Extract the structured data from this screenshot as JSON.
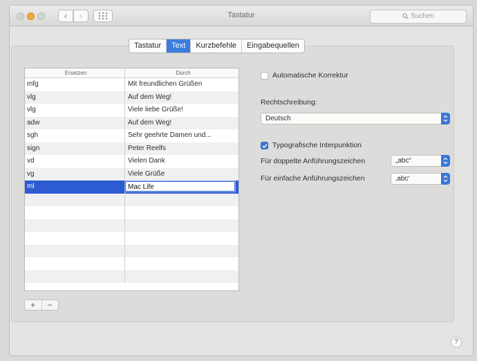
{
  "window": {
    "title": "Tastatur"
  },
  "search": {
    "placeholder": "Suchen"
  },
  "tabs": [
    {
      "label": "Tastatur",
      "active": false
    },
    {
      "label": "Text",
      "active": true
    },
    {
      "label": "Kurzbefehle",
      "active": false
    },
    {
      "label": "Eingabequellen",
      "active": false
    }
  ],
  "table": {
    "headers": {
      "replace": "Ersetzen",
      "with": "Durch"
    },
    "rows": [
      {
        "replace": "mfg",
        "with": "Mit freundlichen Grüßen"
      },
      {
        "replace": "vlg",
        "with": "Auf dem Weg!"
      },
      {
        "replace": "vlg",
        "with": "Viele liebe Grüße!"
      },
      {
        "replace": "adw",
        "with": "Auf dem Weg!"
      },
      {
        "replace": "sgh",
        "with": "Sehr geehrte Damen und..."
      },
      {
        "replace": "sign",
        "with": "Peter Reelfs"
      },
      {
        "replace": "vd",
        "with": "Vielen Dank"
      },
      {
        "replace": "vg",
        "with": "Viele Grüße"
      },
      {
        "replace": "ml",
        "with": "Mac Life",
        "selected": true,
        "editing": true
      }
    ]
  },
  "buttons": {
    "add": "+",
    "remove": "−",
    "help": "?"
  },
  "options": {
    "autocorrect": {
      "label": "Automatische Korrektur",
      "checked": false
    },
    "spelling_label": "Rechtschreibung:",
    "spelling_value": "Deutsch",
    "smart_punct": {
      "label": "Typografische Interpunktion",
      "checked": true
    },
    "double_quotes_label": "Für doppelte Anführungszeichen",
    "double_quotes_value": "„abc“",
    "single_quotes_label": "Für einfache Anführungszeichen",
    "single_quotes_value": "‚abc‘"
  },
  "colors": {
    "accent": "#3a76d6",
    "selection": "#2c5bd2"
  }
}
